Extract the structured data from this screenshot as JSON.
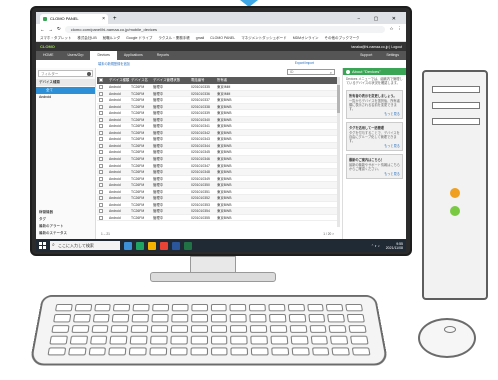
{
  "browser": {
    "tab_title": "CLOMO PANEL",
    "new_tab": "+",
    "window_controls": "− ▢ ✕",
    "url": "clomo.com/panel/hi-namaa.co.jp/mobile_devices",
    "bookmarks": [
      "スマホ・タブレット",
      "株式会社LIB",
      "就職ルンダ",
      "Google ドライブ",
      "ラクスル・業務手帳",
      "gmail",
      "CLOMO PANEL",
      "マネジメントダッシュボード",
      "MDMオンライン",
      "その他のブックマーク"
    ]
  },
  "app": {
    "logo": "CLOMO",
    "user": "tanaka@hi-namaa.co.jp | Logout",
    "nav": [
      "HOME",
      "Users/Grp",
      "Devices",
      "Applications",
      "Reports"
    ],
    "nav_active": "Devices",
    "nav_right": [
      "Support",
      "Settings"
    ]
  },
  "toolbar": {
    "register_link": "端末の新規登録を追加",
    "export_link": "Export/Import"
  },
  "sidebar": {
    "filter_placeholder": "フィルター",
    "group_header": "デバイス種類",
    "selected_item": "全て",
    "item": "Android",
    "bottom_items": [
      "稼働機器",
      "タグ",
      "最新のアラート",
      "最新のステータス"
    ]
  },
  "table": {
    "search_placeholder": "ID",
    "columns": [
      "",
      "デバイス種類",
      "デバイス名",
      "デバイス管理状態",
      "電話番号",
      "所有者"
    ],
    "rows": [
      [
        "Android",
        "TC26FM",
        "管理中",
        "0201010335",
        "東京IMM"
      ],
      [
        "Android",
        "TC26FM",
        "管理中",
        "0201010336",
        "東京IMM"
      ],
      [
        "Android",
        "TC26FM",
        "管理中",
        "0201010337",
        "東京BWB"
      ],
      [
        "Android",
        "TC26FM",
        "管理中",
        "0201010338",
        "東京BWB"
      ],
      [
        "Android",
        "TC26FM",
        "管理中",
        "0201010339",
        "東京BWB"
      ],
      [
        "Android",
        "TC26FM",
        "管理中",
        "0201010340",
        "東京BWB"
      ],
      [
        "Android",
        "TC26FM",
        "管理中",
        "0201010341",
        "東京BWB"
      ],
      [
        "Android",
        "TC26FM",
        "管理中",
        "0201010342",
        "東京BWB"
      ],
      [
        "Android",
        "TC26FM",
        "管理中",
        "0201010343",
        "東京BWB"
      ],
      [
        "Android",
        "TC26FM",
        "管理中",
        "0201010344",
        "東京BWB"
      ],
      [
        "Android",
        "TC26FM",
        "管理中",
        "0201010345",
        "東京BWB"
      ],
      [
        "Android",
        "TC26FM",
        "管理中",
        "0201010346",
        "東京BWB"
      ],
      [
        "Android",
        "TC26FM",
        "管理中",
        "0201010347",
        "東京BWB"
      ],
      [
        "Android",
        "TC26FM",
        "管理中",
        "0201010348",
        "東京BWB"
      ],
      [
        "Android",
        "TC26FM",
        "管理中",
        "0201010349",
        "東京BWB"
      ],
      [
        "Android",
        "TC26FM",
        "管理中",
        "0201010350",
        "東京BWB"
      ],
      [
        "Android",
        "TC26FM",
        "管理中",
        "0201010351",
        "東京BWB"
      ],
      [
        "Android",
        "TC26FM",
        "管理中",
        "0201010352",
        "東京BWB"
      ],
      [
        "Android",
        "TC26FM",
        "管理中",
        "0201010353",
        "東京BWB"
      ],
      [
        "Android",
        "TC26FM",
        "管理中",
        "0201010354",
        "東京BWB"
      ],
      [
        "Android",
        "TC26FM",
        "管理中",
        "0201010355",
        "東京BWB"
      ]
    ],
    "pager_left": "1 – 21",
    "pager_right": "1 / 20 >"
  },
  "rpanel": {
    "title": "About \"Devices\"",
    "intro": "Devices メニューでは、組織内で管理しているデバイスの状況を確認します。",
    "cards": [
      {
        "title": "所有者の表示を変更しましょう。",
        "body": "一覧からデバイスを選択後、所有者欄に表示される名前を変更できます。",
        "more": "もっと見る"
      },
      {
        "title": "タグを活用して一括管理",
        "body": "タグを付与することで、デバイスを自由にグループ化して管理できます。",
        "more": "もっと見る"
      },
      {
        "title": "最新のご案内はこちら！",
        "body": "最新の機能やサポート情報はこちらからご確認ください。",
        "more": "もっと見る"
      }
    ]
  },
  "taskbar": {
    "search_placeholder": "ここに入力して検索",
    "time": "9:55",
    "date": "2021/11/08"
  },
  "colors": {
    "accent_green": "#3aa655",
    "header_dark": "#333333",
    "selection_blue": "#2d8fd5",
    "arrow_blue": "#3fa7e6",
    "led_orange": "#f0a020",
    "led_green": "#7ac943"
  }
}
